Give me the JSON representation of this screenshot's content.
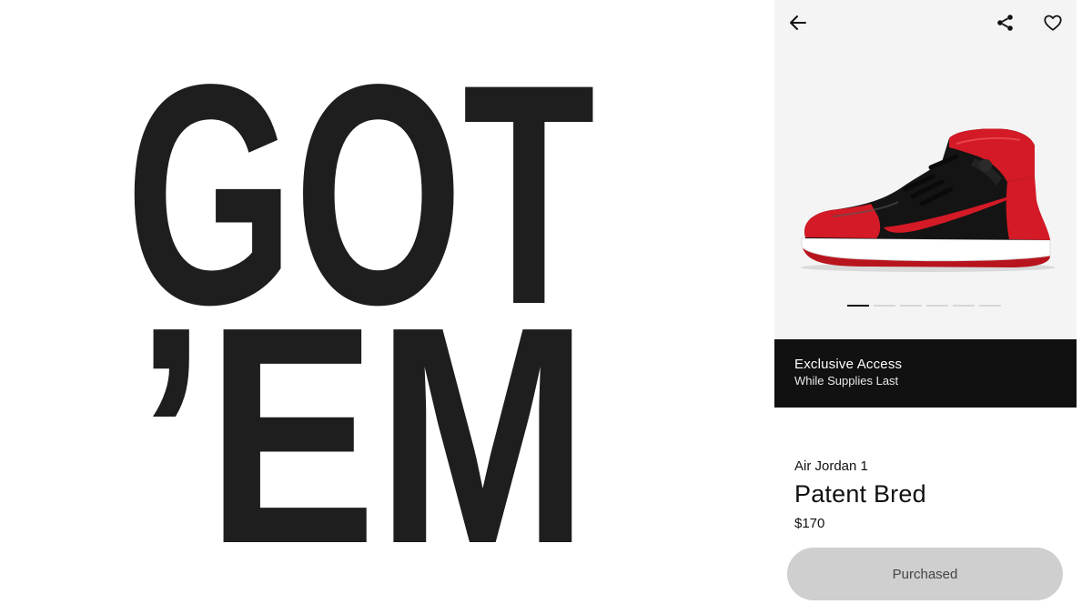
{
  "hero": {
    "line1": "GOT",
    "line2": "’EM"
  },
  "product": {
    "subtitle": "Air Jordan 1",
    "name": "Patent Bred",
    "price": "$170",
    "image_icon": "sneaker-image"
  },
  "banner": {
    "title": "Exclusive Access",
    "subtitle": "While Supplies Last"
  },
  "actions": {
    "purchase_label": "Purchased"
  },
  "carousel": {
    "total": 6,
    "active_index": 0
  },
  "icons": {
    "back": "arrow-left-icon",
    "share": "share-icon",
    "favorite": "heart-icon"
  },
  "colors": {
    "accent_red": "#d31a26",
    "dark": "#111111",
    "panel_bg": "#f4f4f4",
    "button_disabled": "#cfcfcf"
  }
}
